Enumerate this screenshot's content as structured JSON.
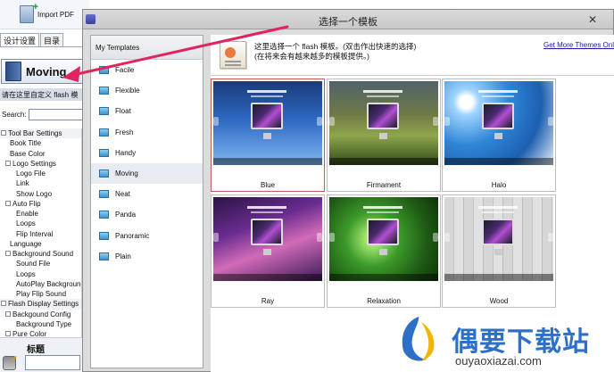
{
  "app": {
    "import_pdf_label": "Import PDF",
    "side_tabs": [
      "设计设置",
      "目录"
    ],
    "current_template_label": "Moving",
    "customize_text": "请在这里自定义 flash 模",
    "search_label": "Search:",
    "bottom_panel_title": "标题"
  },
  "settings_tree": [
    {
      "label": "Tool Bar Settings",
      "level": 0,
      "box": true
    },
    {
      "label": "Book Title",
      "level": 1,
      "box": false
    },
    {
      "label": "Base Color",
      "level": 1,
      "box": false
    },
    {
      "label": "Logo Settings",
      "level": 1,
      "box": true
    },
    {
      "label": "Logo File",
      "level": 2,
      "box": false
    },
    {
      "label": "Link",
      "level": 2,
      "box": false
    },
    {
      "label": "Show Logo",
      "level": 2,
      "box": false
    },
    {
      "label": "Auto Flip",
      "level": 1,
      "box": true
    },
    {
      "label": "Enable",
      "level": 2,
      "box": false
    },
    {
      "label": "Loops",
      "level": 2,
      "box": false
    },
    {
      "label": "Flip Interval",
      "level": 2,
      "box": false
    },
    {
      "label": "Language",
      "level": 1,
      "box": false
    },
    {
      "label": "Background Sound",
      "level": 1,
      "box": true
    },
    {
      "label": "Sound File",
      "level": 2,
      "box": false
    },
    {
      "label": "Loops",
      "level": 2,
      "box": false
    },
    {
      "label": "AutoPlay Backgroun...",
      "level": 2,
      "box": false
    },
    {
      "label": "Play Flip Sound",
      "level": 2,
      "box": false
    },
    {
      "label": "Flash Display Settings",
      "level": 0,
      "box": true
    },
    {
      "label": "Backgound Config",
      "level": 1,
      "box": true
    },
    {
      "label": "Background Type",
      "level": 2,
      "box": false
    },
    {
      "label": "Pure Color",
      "level": 1,
      "box": true
    }
  ],
  "dialog": {
    "title": "选择一个模板",
    "close_glyph": "✕",
    "templates_header": "My Templates",
    "templates": [
      "Facile",
      "Flexible",
      "Float",
      "Fresh",
      "Handy",
      "Moving",
      "Neat",
      "Panda",
      "Panoramic",
      "Plain"
    ],
    "selected_template": "Moving",
    "info_line1": "这里选择一个 flash 模板。(双击作出快速的选择)",
    "info_line2": "(在将来会有越来越多的模板提供。)",
    "more_themes_link": "Get More Themes Online",
    "gallery": [
      {
        "label": "Blue",
        "bg": "bg-blue",
        "selected": true
      },
      {
        "label": "Firmament",
        "bg": "bg-firmament",
        "selected": false
      },
      {
        "label": "Halo",
        "bg": "bg-halo",
        "selected": false
      },
      {
        "label": "Ray",
        "bg": "bg-ray",
        "selected": false
      },
      {
        "label": "Relaxation",
        "bg": "bg-relaxation",
        "selected": false
      },
      {
        "label": "Wood",
        "bg": "bg-wood",
        "selected": false
      }
    ]
  },
  "watermark": {
    "name": "偶要下载站",
    "url": "ouyaoxiazai.com"
  },
  "colors": {
    "arrow": "#e0245e",
    "accent": "#2e70c7"
  }
}
